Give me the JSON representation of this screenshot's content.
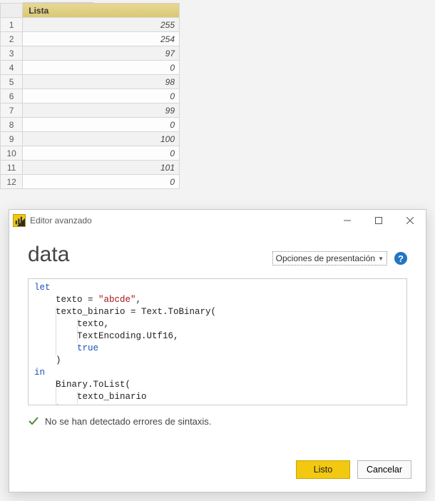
{
  "table": {
    "header": "Lista",
    "rows": [
      {
        "n": "1",
        "v": "255"
      },
      {
        "n": "2",
        "v": "254"
      },
      {
        "n": "3",
        "v": "97"
      },
      {
        "n": "4",
        "v": "0"
      },
      {
        "n": "5",
        "v": "98"
      },
      {
        "n": "6",
        "v": "0"
      },
      {
        "n": "7",
        "v": "99"
      },
      {
        "n": "8",
        "v": "0"
      },
      {
        "n": "9",
        "v": "100"
      },
      {
        "n": "10",
        "v": "0"
      },
      {
        "n": "11",
        "v": "101"
      },
      {
        "n": "12",
        "v": "0"
      }
    ]
  },
  "dialog": {
    "title": "Editor avanzado",
    "query_name": "data",
    "display_options_label": "Opciones de presentación",
    "help_glyph": "?",
    "code": {
      "l1_kw": "let",
      "l2a": "    texto = ",
      "l2b_str": "\"abcde\"",
      "l2c": ",",
      "l3": "    texto_binario = Text.ToBinary(",
      "l4": "        texto,",
      "l5": "        TextEncoding.Utf16,",
      "l6_pad": "        ",
      "l6_kw": "true",
      "l7": "    )",
      "l8_kw": "in",
      "l9": "    Binary.ToList(",
      "l10": "        texto_binario",
      "l11": "    )"
    },
    "status": "No se han detectado errores de sintaxis.",
    "ok_label": "Listo",
    "cancel_label": "Cancelar"
  }
}
